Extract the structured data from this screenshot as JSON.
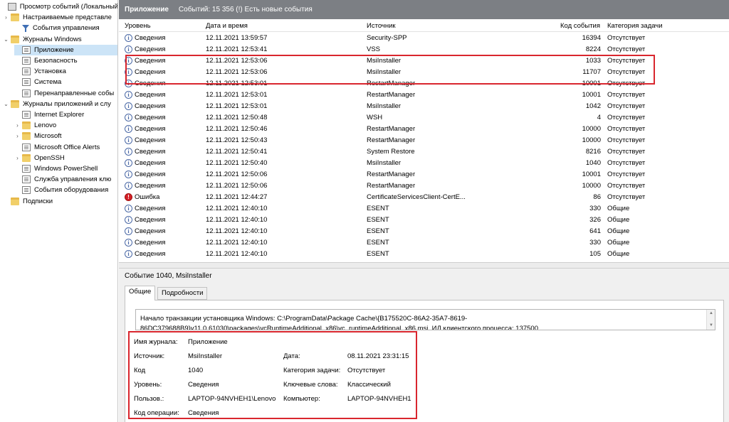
{
  "tree": [
    {
      "label": "Просмотр событий (Локальный",
      "level": 0,
      "arrow": "",
      "icon": "root",
      "name": "tree-root"
    },
    {
      "label": "Настраиваемые представле",
      "level": 1,
      "arrow": "›",
      "icon": "folder",
      "name": "tree-custom-views"
    },
    {
      "label": "События управления",
      "level": 2,
      "arrow": "",
      "icon": "funnel",
      "name": "tree-admin-events"
    },
    {
      "label": "Журналы Windows",
      "level": 1,
      "arrow": "⌄",
      "icon": "folder",
      "name": "tree-windows-logs"
    },
    {
      "label": "Приложение",
      "level": 2,
      "arrow": "",
      "icon": "log",
      "name": "tree-application",
      "selected": true
    },
    {
      "label": "Безопасность",
      "level": 2,
      "arrow": "",
      "icon": "log",
      "name": "tree-security"
    },
    {
      "label": "Установка",
      "level": 2,
      "arrow": "",
      "icon": "log",
      "name": "tree-setup"
    },
    {
      "label": "Система",
      "level": 2,
      "arrow": "",
      "icon": "log",
      "name": "tree-system"
    },
    {
      "label": "Перенаправленные собы",
      "level": 2,
      "arrow": "",
      "icon": "log",
      "name": "tree-forwarded"
    },
    {
      "label": "Журналы приложений и слу",
      "level": 1,
      "arrow": "⌄",
      "icon": "folder",
      "name": "tree-app-services-logs"
    },
    {
      "label": "Internet Explorer",
      "level": 2,
      "arrow": "",
      "icon": "log",
      "name": "tree-internet-explorer"
    },
    {
      "label": "Lenovo",
      "level": 2,
      "arrow": "›",
      "icon": "folder",
      "name": "tree-lenovo"
    },
    {
      "label": "Microsoft",
      "level": 2,
      "arrow": "›",
      "icon": "folder",
      "name": "tree-microsoft"
    },
    {
      "label": "Microsoft Office Alerts",
      "level": 2,
      "arrow": "",
      "icon": "log",
      "name": "tree-office-alerts"
    },
    {
      "label": "OpenSSH",
      "level": 2,
      "arrow": "›",
      "icon": "folder",
      "name": "tree-openssh"
    },
    {
      "label": "Windows PowerShell",
      "level": 2,
      "arrow": "",
      "icon": "log",
      "name": "tree-powershell"
    },
    {
      "label": "Служба управления клю",
      "level": 2,
      "arrow": "",
      "icon": "log",
      "name": "tree-key-mgmt"
    },
    {
      "label": "События оборудования",
      "level": 2,
      "arrow": "",
      "icon": "log",
      "name": "tree-hardware-events"
    },
    {
      "label": "Подписки",
      "level": 1,
      "arrow": "",
      "icon": "folder",
      "name": "tree-subscriptions"
    }
  ],
  "header": {
    "title": "Приложение",
    "summary": "Событий: 15 356 (!) Есть новые события"
  },
  "columns": {
    "level": "Уровень",
    "datetime": "Дата и время",
    "source": "Источник",
    "code": "Код события",
    "category": "Категория задачи"
  },
  "events": [
    {
      "level": "Сведения",
      "type": "info",
      "datetime": "12.11.2021 13:59:57",
      "source": "Security-SPP",
      "code": "16394",
      "category": "Отсутствует"
    },
    {
      "level": "Сведения",
      "type": "info",
      "datetime": "12.11.2021 12:53:41",
      "source": "VSS",
      "code": "8224",
      "category": "Отсутствует"
    },
    {
      "level": "Сведения",
      "type": "info",
      "datetime": "12.11.2021 12:53:06",
      "source": "MsiInstaller",
      "code": "1033",
      "category": "Отсутствует"
    },
    {
      "level": "Сведения",
      "type": "info",
      "datetime": "12.11.2021 12:53:06",
      "source": "MsiInstaller",
      "code": "11707",
      "category": "Отсутствует"
    },
    {
      "level": "Сведения",
      "type": "info",
      "datetime": "12.11.2021 12:53:01",
      "source": "RestartManager",
      "code": "10001",
      "category": "Отсутствует"
    },
    {
      "level": "Сведения",
      "type": "info",
      "datetime": "12.11.2021 12:53:01",
      "source": "RestartManager",
      "code": "10001",
      "category": "Отсутствует"
    },
    {
      "level": "Сведения",
      "type": "info",
      "datetime": "12.11.2021 12:53:01",
      "source": "MsiInstaller",
      "code": "1042",
      "category": "Отсутствует"
    },
    {
      "level": "Сведения",
      "type": "info",
      "datetime": "12.11.2021 12:50:48",
      "source": "WSH",
      "code": "4",
      "category": "Отсутствует"
    },
    {
      "level": "Сведения",
      "type": "info",
      "datetime": "12.11.2021 12:50:46",
      "source": "RestartManager",
      "code": "10000",
      "category": "Отсутствует"
    },
    {
      "level": "Сведения",
      "type": "info",
      "datetime": "12.11.2021 12:50:43",
      "source": "RestartManager",
      "code": "10000",
      "category": "Отсутствует"
    },
    {
      "level": "Сведения",
      "type": "info",
      "datetime": "12.11.2021 12:50:41",
      "source": "System Restore",
      "code": "8216",
      "category": "Отсутствует"
    },
    {
      "level": "Сведения",
      "type": "info",
      "datetime": "12.11.2021 12:50:40",
      "source": "MsiInstaller",
      "code": "1040",
      "category": "Отсутствует"
    },
    {
      "level": "Сведения",
      "type": "info",
      "datetime": "12.11.2021 12:50:06",
      "source": "RestartManager",
      "code": "10001",
      "category": "Отсутствует"
    },
    {
      "level": "Сведения",
      "type": "info",
      "datetime": "12.11.2021 12:50:06",
      "source": "RestartManager",
      "code": "10000",
      "category": "Отсутствует"
    },
    {
      "level": "Ошибка",
      "type": "error",
      "datetime": "12.11.2021 12:44:27",
      "source": "CertificateServicesClient-CertE...",
      "code": "86",
      "category": "Отсутствует"
    },
    {
      "level": "Сведения",
      "type": "info",
      "datetime": "12.11.2021 12:40:10",
      "source": "ESENT",
      "code": "330",
      "category": "Общие"
    },
    {
      "level": "Сведения",
      "type": "info",
      "datetime": "12.11.2021 12:40:10",
      "source": "ESENT",
      "code": "326",
      "category": "Общие"
    },
    {
      "level": "Сведения",
      "type": "info",
      "datetime": "12.11.2021 12:40:10",
      "source": "ESENT",
      "code": "641",
      "category": "Общие"
    },
    {
      "level": "Сведения",
      "type": "info",
      "datetime": "12.11.2021 12:40:10",
      "source": "ESENT",
      "code": "330",
      "category": "Общие"
    },
    {
      "level": "Сведения",
      "type": "info",
      "datetime": "12.11.2021 12:40:10",
      "source": "ESENT",
      "code": "105",
      "category": "Общие"
    }
  ],
  "detail": {
    "title": "Событие 1040, MsiInstaller",
    "tabs": [
      "Общие",
      "Подробности"
    ],
    "description": "Начало транзакции установщика Windows: C:\\ProgramData\\Package Cache\\{B175520C-86A2-35A7-8619-86DC379688B9}v11.0.61030\\packages\\vcRuntimeAdditional_x86\\vc_runtimeAdditional_x86.msi. ИД клиентского процесса: 137500.",
    "props": {
      "log_label": "Имя журнала:",
      "log_value": "Приложение",
      "source_label": "Источник:",
      "source_value": "MsiInstaller",
      "date_label": "Дата:",
      "date_value": "08.11.2021 23:31:15",
      "code_label": "Код",
      "code_value": "1040",
      "category_label": "Категория задачи:",
      "category_value": "Отсутствует",
      "level_label": "Уровень:",
      "level_value": "Сведения",
      "keywords_label": "Ключевые слова:",
      "keywords_value": "Классический",
      "user_label": "Пользов.:",
      "user_value": "LAPTOP-94NVHEH1\\Lenovo",
      "computer_label": "Компьютер:",
      "computer_value": "LAPTOP-94NVHEH1",
      "opcode_label": "Код операции:",
      "opcode_value": "Сведения"
    }
  },
  "colors": {
    "header_bg": "#7c7f84",
    "highlight": "#d9262e",
    "selection": "#cce4f7",
    "info_icon": "#4b69a6",
    "error_icon": "#d41f26"
  }
}
